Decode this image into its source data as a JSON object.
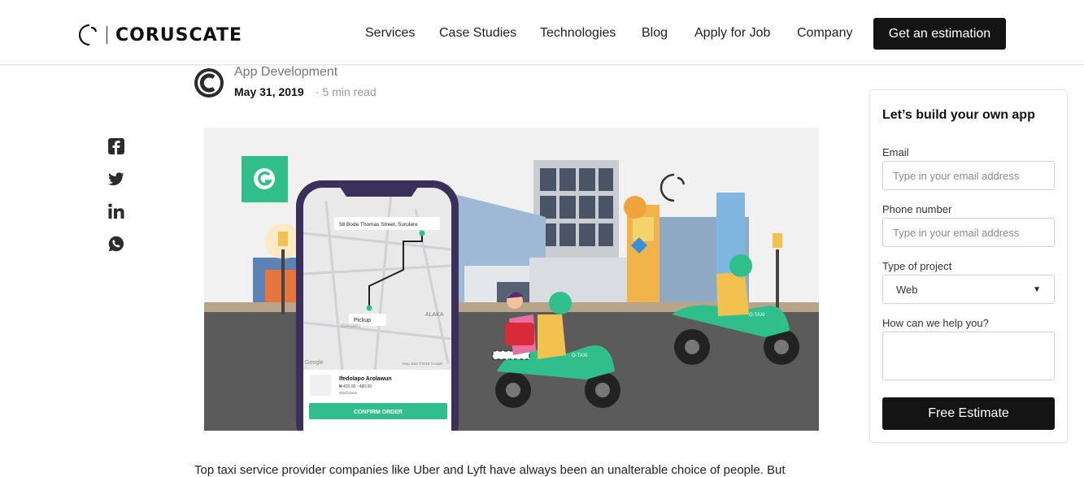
{
  "brand": {
    "name": "CORUSCATE",
    "logo_icon": "coruscate-logo-icon"
  },
  "nav": {
    "items": [
      "Services",
      "Case Studies",
      "Technologies",
      "Blog",
      "Apply for Job",
      "Company"
    ],
    "cta_label": "Get an estimation"
  },
  "post": {
    "category": "App Development",
    "date": "May 31, 2019",
    "read_time": "· 5 min read",
    "intro": "Top taxi service provider companies like Uber and Lyft have always been an unalterable choice of people. But"
  },
  "share": {
    "icons": [
      "facebook-icon",
      "twitter-icon",
      "linkedin-icon",
      "whatsapp-icon"
    ]
  },
  "hero": {
    "address": "58 Bode Thomas Street, Surulere",
    "pickup_label": "Pickup",
    "driver_name": "Ifedolapo Arolawun",
    "fare": "₦ 420.00 - 480.00",
    "distance": "4km/12min",
    "confirm_label": "CONFIRM ORDER",
    "map_watermark": "Google",
    "map_credit": "Map data ©2018 Google",
    "map_labels": [
      "ALAKA",
      "IGANMU"
    ],
    "bike_label": "O-TAXI"
  },
  "form": {
    "title": "Let’s build your own app",
    "email_label": "Email",
    "email_placeholder": "Type in your email address",
    "phone_label": "Phone number",
    "phone_placeholder": "Type in your email address",
    "project_label": "Type of project",
    "project_value": "Web",
    "help_label": "How can we help you?",
    "submit_label": "Free Estimate"
  },
  "colors": {
    "accent_green": "#2fbf8c",
    "dark": "#141414",
    "road": "#5b5b5b",
    "phone_frame": "#3b2f5c"
  }
}
